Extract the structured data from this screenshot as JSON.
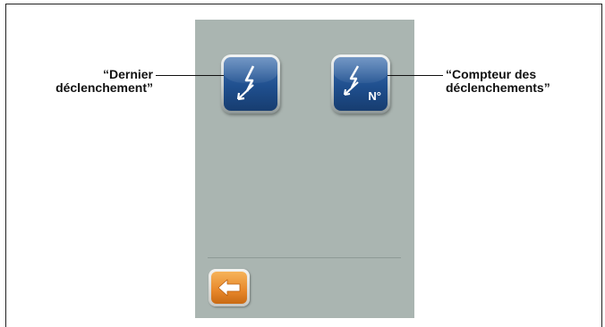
{
  "callouts": {
    "left": {
      "line1": "“Dernier",
      "line2": "déclenchement”"
    },
    "right": {
      "line1": "“Compteur des",
      "line2": "déclenchements”"
    }
  },
  "buttons": {
    "last_trip": {
      "icon": "lightning-arrow-icon"
    },
    "trip_counter": {
      "icon": "lightning-arrow-counter-icon",
      "badge": "N°"
    },
    "back": {
      "icon": "arrow-left-icon"
    }
  },
  "colors": {
    "screen_bg": "#aab5b1",
    "icon_blue": "#1f4f8e",
    "back_orange": "#e7872a"
  }
}
